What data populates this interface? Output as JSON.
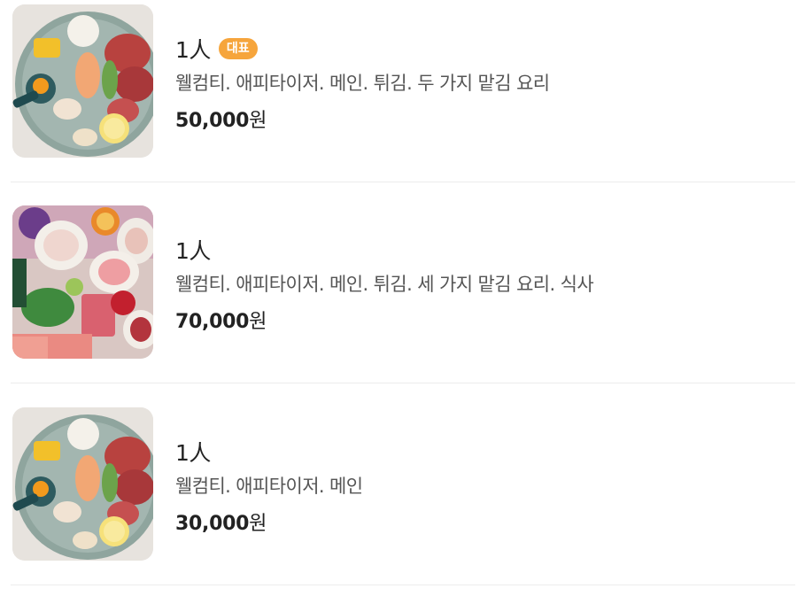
{
  "menu_items": [
    {
      "name": "1人",
      "badge": "대표",
      "description": "웰컴티. 애피타이저. 메인. 튀김. 두 가지 맡김 요리",
      "price": "50,000",
      "currency": "원",
      "image": "sashimi-platter-photo"
    },
    {
      "name": "1人",
      "description": "웰컴티. 애피타이저. 메인. 튀김. 세 가지 맡김 요리. 식사",
      "price": "70,000",
      "currency": "원",
      "image": "assorted-sashimi-spread-photo"
    },
    {
      "name": "1人",
      "description": "웰컴티. 애피타이저. 메인",
      "price": "30,000",
      "currency": "원",
      "image": "sashimi-platter-photo"
    }
  ],
  "colors": {
    "badge_bg": "#f6a53c",
    "divider": "#ececec",
    "plate": "#8fa59e"
  }
}
